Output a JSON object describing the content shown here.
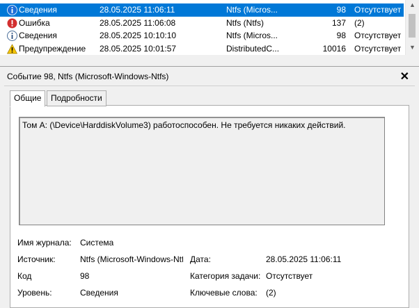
{
  "event_list": {
    "rows": [
      {
        "level": "Сведения",
        "date": "28.05.2025 11:06:11",
        "source": "Ntfs (Micros...",
        "id": "98",
        "category": "Отсутствует",
        "icon": "info-icon",
        "selected": true
      },
      {
        "level": "Ошибка",
        "date": "28.05.2025 11:06:08",
        "source": "Ntfs (Ntfs)",
        "id": "137",
        "category": "(2)",
        "icon": "error-icon",
        "selected": false
      },
      {
        "level": "Сведения",
        "date": "28.05.2025 10:10:10",
        "source": "Ntfs (Micros...",
        "id": "98",
        "category": "Отсутствует",
        "icon": "info-icon",
        "selected": false
      },
      {
        "level": "Предупреждение",
        "date": "28.05.2025 10:01:57",
        "source": "DistributedC...",
        "id": "10016",
        "category": "Отсутствует",
        "icon": "warning-icon",
        "selected": false
      }
    ]
  },
  "detail": {
    "title": "Событие 98, Ntfs (Microsoft-Windows-Ntfs)",
    "close_glyph": "✕",
    "tabs": [
      "Общие",
      "Подробности"
    ],
    "description": "Том A: (\\Device\\HarddiskVolume3) работоспособен.  Не требуется никаких действий.",
    "fields": {
      "log_label": "Имя журнала:",
      "log_value": "Система",
      "source_label": "Источник:",
      "source_value": "Ntfs (Microsoft-Windows-Ntfs)",
      "date_label": "Дата:",
      "date_value": "28.05.2025 11:06:11",
      "code_label": "Код",
      "code_value": "98",
      "task_label": "Категория задачи:",
      "task_value": "Отсутствует",
      "level_label": "Уровень:",
      "level_value": "Сведения",
      "keywords_label": "Ключевые слова:",
      "keywords_value": "(2)"
    }
  },
  "colors": {
    "selection": "#0078d7",
    "info": "#1e6fd9",
    "error": "#d32f2f",
    "warning": "#f5c400"
  }
}
